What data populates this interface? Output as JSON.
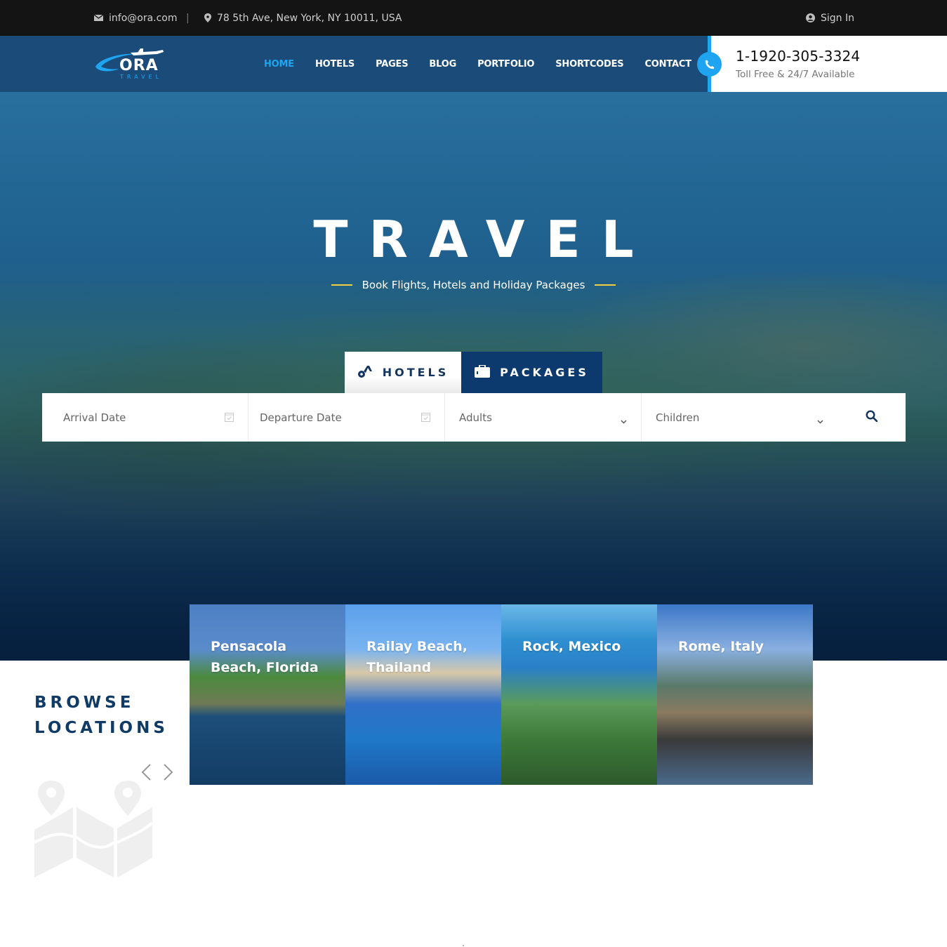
{
  "topbar": {
    "email": "info@ora.com",
    "separator": "|",
    "address": "78 5th Ave, New York, NY 10011, USA",
    "sign_in": "Sign In"
  },
  "header": {
    "logo": {
      "name": "ORA",
      "tagline": "TRAVEL"
    },
    "nav": [
      {
        "label": "HOME",
        "active": true
      },
      {
        "label": "HOTELS",
        "active": false
      },
      {
        "label": "PAGES",
        "active": false
      },
      {
        "label": "BLOG",
        "active": false
      },
      {
        "label": "PORTFOLIO",
        "active": false
      },
      {
        "label": "SHORTCODES",
        "active": false
      },
      {
        "label": "CONTACT",
        "active": false
      }
    ],
    "phone": {
      "number": "1-1920-305-3324",
      "subtitle": "Toll Free & 24/7 Available"
    }
  },
  "hero": {
    "title": "TRAVEL",
    "subtitle": "Book Flights, Hotels and Holiday Packages",
    "tabs": [
      {
        "label": "HOTELS",
        "icon": "hotel-key-icon",
        "active": false
      },
      {
        "label": "PACKAGES",
        "icon": "suitcase-icon",
        "active": true
      }
    ],
    "search": {
      "arrival_placeholder": "Arrival Date",
      "departure_placeholder": "Departure Date",
      "adults_value": "Adults",
      "children_value": "Children"
    }
  },
  "browse": {
    "title_line1": "BROWSE",
    "title_line2": "LOCATIONS",
    "locations": [
      {
        "name": "Pensacola Beach, Florida"
      },
      {
        "name": "Railay Beach, Thailand"
      },
      {
        "name": "Rock, Mexico"
      },
      {
        "name": "Rome, Italy"
      }
    ]
  },
  "colors": {
    "topbar_bg": "#141414",
    "header_bg": "#1b4c79",
    "accent": "#1ea4f0",
    "navy": "#0d3a6e",
    "heading": "#0f3b66",
    "subtitle_line": "#f4d03f"
  }
}
